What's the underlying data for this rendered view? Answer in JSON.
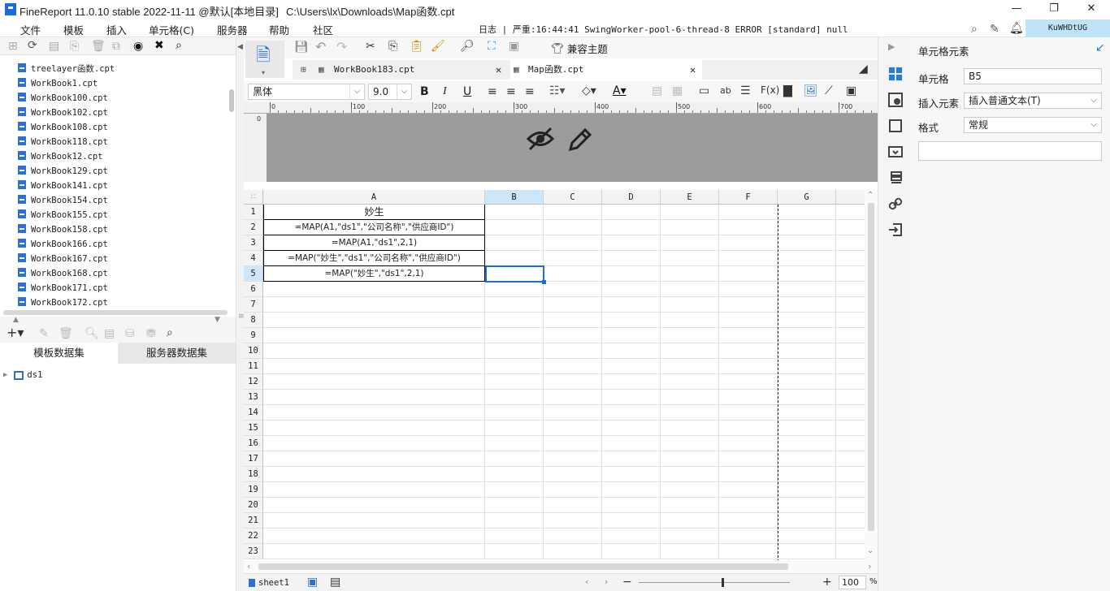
{
  "titlebar": {
    "title": "FineReport 11.0.10 stable 2022-11-11 @默认[本地目录]",
    "path": "C:\\Users\\lx\\Downloads\\Map函数.cpt",
    "minimize": "—",
    "maximize": "❐",
    "close": "✕"
  },
  "menu": [
    "文件",
    "模板",
    "插入",
    "单元格(C)",
    "服务器",
    "帮助",
    "社区"
  ],
  "log": "日志 | 严重:16:44:41 SwingWorker-pool-6-thread-8 ERROR [standard] null",
  "user": "KuWHDtUG",
  "tree_items": [
    "treelayer函数.cpt",
    "WorkBook1.cpt",
    "WorkBook100.cpt",
    "WorkBook102.cpt",
    "WorkBook108.cpt",
    "WorkBook118.cpt",
    "WorkBook12.cpt",
    "WorkBook129.cpt",
    "WorkBook141.cpt",
    "WorkBook154.cpt",
    "WorkBook155.cpt",
    "WorkBook158.cpt",
    "WorkBook166.cpt",
    "WorkBook167.cpt",
    "WorkBook168.cpt",
    "WorkBook171.cpt",
    "WorkBook172.cpt"
  ],
  "dataset_tabs": [
    "模板数据集",
    "服务器数据集"
  ],
  "datasets": [
    "ds1"
  ],
  "doc_tabs": [
    "WorkBook183.cpt",
    "Map函数.cpt"
  ],
  "theme_button": "兼容主题",
  "font": {
    "name": "黑体",
    "size": "9.0"
  },
  "ruler_ticks": [
    "0",
    "100",
    "200",
    "300",
    "400",
    "500",
    "600",
    "700"
  ],
  "columns": [
    "A",
    "B",
    "C",
    "D",
    "E",
    "F",
    "G"
  ],
  "rows": [
    "1",
    "2",
    "3",
    "4",
    "5",
    "6",
    "7",
    "8",
    "9",
    "10",
    "11",
    "12",
    "13",
    "14",
    "15",
    "16",
    "17",
    "18",
    "19",
    "20",
    "21",
    "22",
    "23"
  ],
  "cells": [
    "妙生",
    "=MAP(A1,\"ds1\",\"公司名称\",\"供应商ID\")",
    "=MAP(A1,\"ds1\",2,1)",
    "=MAP(\"妙生\",\"ds1\",\"公司名称\",\"供应商ID\")",
    "=MAP(\"妙生\",\"ds1\",2,1)"
  ],
  "selected_cell": "B5",
  "sheet": "sheet1",
  "zoom": "100",
  "zoom_unit": "%",
  "panel": {
    "title": "单元格元素",
    "cell_label": "单元格",
    "cell_value": "B5",
    "insert_label": "插入元素",
    "insert_value": "插入普通文本(T)",
    "format_label": "格式",
    "format_value": "常规"
  },
  "colors": {
    "accent": "#1d6bd8",
    "selection": "#1e6fd9",
    "user_bg": "#bfe3f7"
  }
}
